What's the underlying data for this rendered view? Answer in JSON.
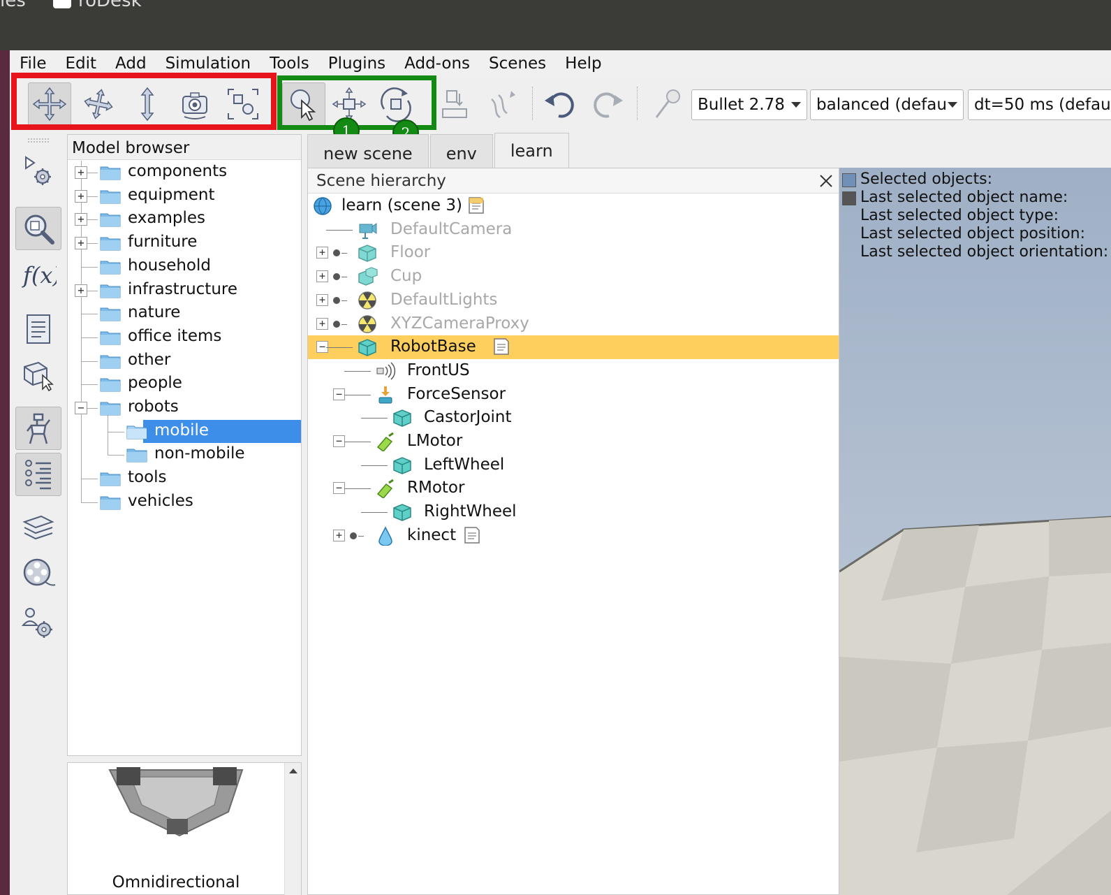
{
  "os": {
    "left_text": "ies",
    "app_title": "roDesk"
  },
  "menubar": [
    "File",
    "Edit",
    "Add",
    "Simulation",
    "Tools",
    "Plugins",
    "Add-ons",
    "Scenes",
    "Help"
  ],
  "toolbar": {
    "engine_combo": "Bullet 2.78",
    "accuracy_combo": "balanced (defau",
    "timestep_combo": "dt=50 ms (defau",
    "badge_1": "1",
    "badge_2": "2"
  },
  "model_browser": {
    "title": "Model browser",
    "items": [
      {
        "label": "components"
      },
      {
        "label": "equipment"
      },
      {
        "label": "examples"
      },
      {
        "label": "furniture"
      },
      {
        "label": "household"
      },
      {
        "label": "infrastructure"
      },
      {
        "label": "nature"
      },
      {
        "label": "office items"
      },
      {
        "label": "other"
      },
      {
        "label": "people"
      },
      {
        "label": "robots"
      },
      {
        "label": "mobile"
      },
      {
        "label": "non-mobile"
      },
      {
        "label": "tools"
      },
      {
        "label": "vehicles"
      }
    ],
    "preview_caption": "Omnidirectional"
  },
  "tabs": [
    "new scene",
    "env",
    "learn"
  ],
  "scene_hierarchy": {
    "title": "Scene hierarchy",
    "items": [
      {
        "label": "learn (scene 3)"
      },
      {
        "label": "DefaultCamera"
      },
      {
        "label": "Floor"
      },
      {
        "label": "Cup"
      },
      {
        "label": "DefaultLights"
      },
      {
        "label": "XYZCameraProxy"
      },
      {
        "label": "RobotBase"
      },
      {
        "label": "FrontUS"
      },
      {
        "label": "ForceSensor"
      },
      {
        "label": "CastorJoint"
      },
      {
        "label": "LMotor"
      },
      {
        "label": "LeftWheel"
      },
      {
        "label": "RMotor"
      },
      {
        "label": "RightWheel"
      },
      {
        "label": "kinect"
      }
    ]
  },
  "viewport": {
    "info_lines": [
      "Selected objects:",
      "Last selected object name:",
      "Last selected object type:",
      "Last selected object position:",
      "Last selected object orientation:"
    ]
  },
  "colors": {
    "selection_blue": "#3d8ee8",
    "scene_selection": "#fecf5c",
    "highlight_red": "#e8141c",
    "highlight_green": "#138a13"
  }
}
